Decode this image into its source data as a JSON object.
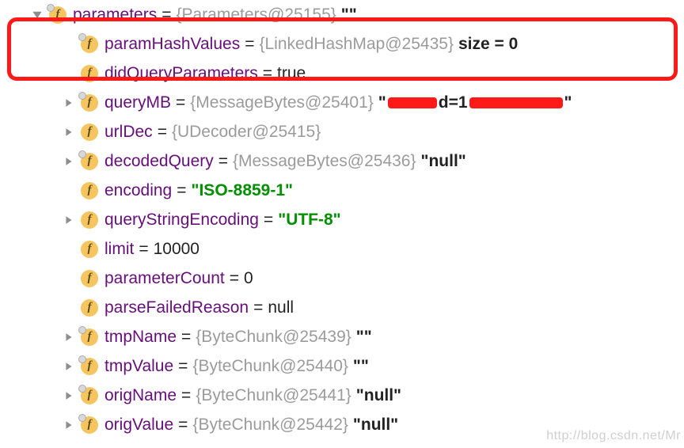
{
  "root": {
    "name": "parameters",
    "ref": "{Parameters@25155}",
    "suffix": "\"\""
  },
  "items": [
    {
      "name": "paramHashValues",
      "ref": "{LinkedHashMap@25435}",
      "suffix": "  size = 0",
      "lock": true
    },
    {
      "name": "didQueryParameters",
      "value_dark": "true"
    },
    {
      "name": "queryMB",
      "ref": "{MessageBytes@25401}",
      "redacted": true,
      "arrow": true,
      "lock": true
    },
    {
      "name": "urlDec",
      "ref": "{UDecoder@25415}",
      "arrow": true
    },
    {
      "name": "decodedQuery",
      "ref": "{MessageBytes@25436}",
      "suffix": "\"null\"",
      "arrow": true,
      "lock": true
    },
    {
      "name": "encoding",
      "value_green": "\"ISO-8859-1\""
    },
    {
      "name": "queryStringEncoding",
      "value_green": "\"UTF-8\"",
      "arrow": true
    },
    {
      "name": "limit",
      "value_dark": "10000"
    },
    {
      "name": "parameterCount",
      "value_dark": "0"
    },
    {
      "name": "parseFailedReason",
      "value_dark": "null"
    },
    {
      "name": "tmpName",
      "ref": "{ByteChunk@25439}",
      "suffix": "\"\"",
      "arrow": true,
      "lock": true
    },
    {
      "name": "tmpValue",
      "ref": "{ByteChunk@25440}",
      "suffix": "\"\"",
      "arrow": true,
      "lock": true
    },
    {
      "name": "origName",
      "ref": "{ByteChunk@25441}",
      "suffix": "\"null\"",
      "arrow": true,
      "lock": true
    },
    {
      "name": "origValue",
      "ref": "{ByteChunk@25442}",
      "suffix": "\"null\"",
      "arrow": true,
      "lock": true
    }
  ],
  "eq": "=",
  "redacted_mid": "d=1",
  "watermark": "http://blog.csdn.net/Mr"
}
